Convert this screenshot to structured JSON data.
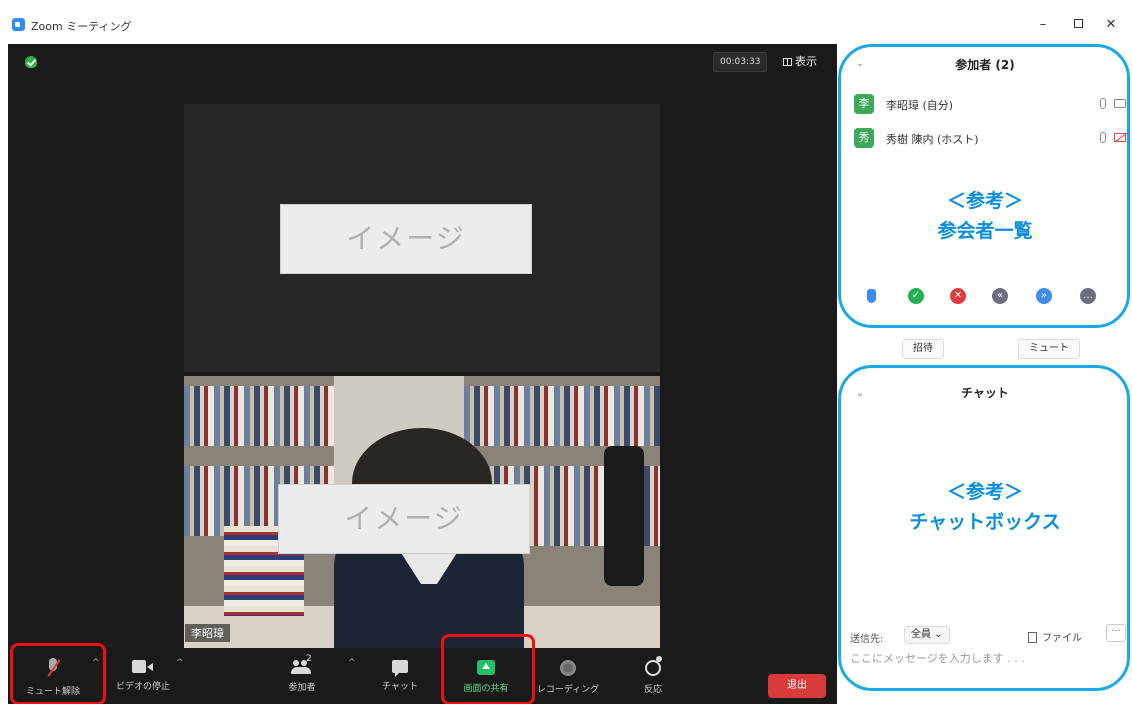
{
  "window": {
    "title": "Zoom ミーティング",
    "minimize": "–",
    "close": "✕"
  },
  "meeting": {
    "timer": "00:03:33",
    "view_label": "表示",
    "placeholder_top": "イメージ",
    "placeholder_bottom": "イメージ",
    "video_name": "李昭璋"
  },
  "toolbar": {
    "unmute": "ミュート解除",
    "stop_video": "ビデオの停止",
    "participants": "参加者",
    "participant_count": "2",
    "chat": "チャット",
    "share": "画面の共有",
    "record": "レコーディング",
    "reactions": "反応",
    "leave": "退出"
  },
  "participants_panel": {
    "title": "参加者 (2)",
    "items": [
      {
        "initial": "李",
        "name": "李昭璋 (自分)",
        "video_off": false
      },
      {
        "initial": "秀",
        "name": "秀樹 陳内 (ホスト)",
        "video_off": true
      }
    ],
    "invite": "招待",
    "mute_all": "ミュート"
  },
  "annotations": {
    "participants_note_line1": "＜参考＞",
    "participants_note_line2": "参会者一覧",
    "chat_note_line1": "＜参考＞",
    "chat_note_line2": "チャットボックス"
  },
  "chat_panel": {
    "title": "チャット",
    "to_label": "送信先:",
    "to_value": "全員 ⌄",
    "file_label": "ファイル",
    "more": "···",
    "input_placeholder": "ここにメッセージを入力します . . ."
  },
  "colors": {
    "highlight_red": "#ee1111",
    "highlight_blue": "#19a9e8",
    "share_green": "#23c065",
    "leave_red": "#d93a3a"
  }
}
